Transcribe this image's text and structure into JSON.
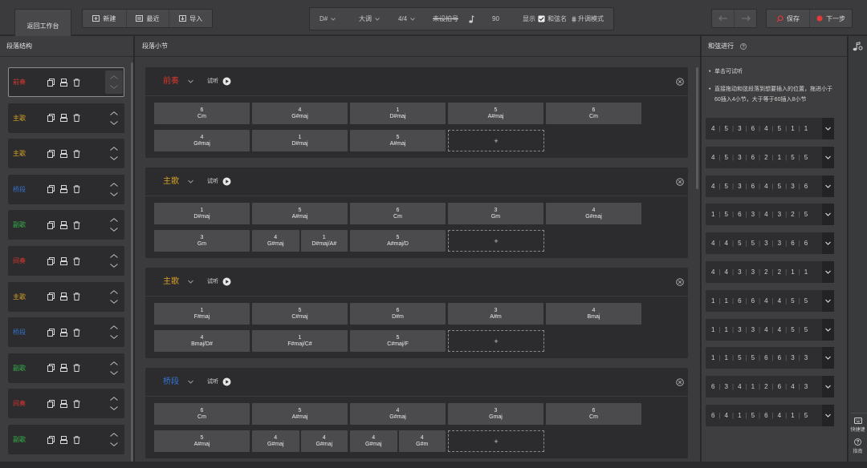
{
  "toolbar": {
    "back_label": "返回工作台",
    "new_label": "新建",
    "recent_label": "最近",
    "import_label": "导入",
    "key": "D#",
    "mode": "大调",
    "time_signature": "4/4",
    "struck_item": "未设拍号",
    "tempo": "90",
    "show_label": "显示",
    "chord_name_label": "和弦名",
    "chord_name_checked": true,
    "sharp_mode_label": "升调模式",
    "save_label": "保存",
    "next_label": "下一步"
  },
  "section_panel": {
    "title": "段落结构",
    "items": [
      {
        "label": "前奏",
        "color": "#d9362e",
        "selected": true
      },
      {
        "label": "主歌",
        "color": "#d6a024"
      },
      {
        "label": "主歌",
        "color": "#d6a024"
      },
      {
        "label": "桥段",
        "color": "#3575d4"
      },
      {
        "label": "副歌",
        "color": "#35b04a"
      },
      {
        "label": "间奏",
        "color": "#d9362e"
      },
      {
        "label": "主歌",
        "color": "#d6a024"
      },
      {
        "label": "桥段",
        "color": "#3575d4"
      },
      {
        "label": "副歌",
        "color": "#35b04a"
      },
      {
        "label": "间奏",
        "color": "#d9362e"
      },
      {
        "label": "副歌",
        "color": "#35b04a"
      }
    ]
  },
  "bar_panel": {
    "title": "段落小节",
    "listen_label": "试听",
    "add_symbol": "+",
    "sections": [
      {
        "title": "前奏",
        "color": "#d9362e",
        "rows": [
          [
            {
              "type": "bar",
              "chords": [
                {
                  "degree": "6",
                  "name": "Cm"
                }
              ]
            },
            {
              "type": "bar",
              "chords": [
                {
                  "degree": "4",
                  "name": "G#maj"
                }
              ]
            },
            {
              "type": "bar",
              "chords": [
                {
                  "degree": "1",
                  "name": "D#maj"
                }
              ]
            },
            {
              "type": "bar",
              "chords": [
                {
                  "degree": "5",
                  "name": "A#maj"
                }
              ]
            },
            {
              "type": "bar",
              "chords": [
                {
                  "degree": "6",
                  "name": "Cm"
                }
              ]
            }
          ],
          [
            {
              "type": "bar",
              "chords": [
                {
                  "degree": "4",
                  "name": "G#maj"
                }
              ]
            },
            {
              "type": "bar",
              "chords": [
                {
                  "degree": "1",
                  "name": "D#maj"
                }
              ]
            },
            {
              "type": "bar",
              "chords": [
                {
                  "degree": "5",
                  "name": "A#maj"
                }
              ]
            },
            {
              "type": "add"
            }
          ]
        ]
      },
      {
        "title": "主歌",
        "color": "#d6a024",
        "rows": [
          [
            {
              "type": "bar",
              "chords": [
                {
                  "degree": "1",
                  "name": "D#maj"
                }
              ]
            },
            {
              "type": "bar",
              "chords": [
                {
                  "degree": "5",
                  "name": "A#maj"
                }
              ]
            },
            {
              "type": "bar",
              "chords": [
                {
                  "degree": "6",
                  "name": "Cm"
                }
              ]
            },
            {
              "type": "bar",
              "chords": [
                {
                  "degree": "3",
                  "name": "Gm"
                }
              ]
            },
            {
              "type": "bar",
              "chords": [
                {
                  "degree": "4",
                  "name": "G#maj"
                }
              ]
            }
          ],
          [
            {
              "type": "bar",
              "chords": [
                {
                  "degree": "3",
                  "name": "Gm"
                }
              ]
            },
            {
              "type": "bar",
              "chords": [
                {
                  "degree": "4",
                  "name": "G#maj"
                },
                {
                  "degree": "1",
                  "name": "D#maj/A#"
                }
              ]
            },
            {
              "type": "bar",
              "chords": [
                {
                  "degree": "5",
                  "name": "A#maj/D"
                }
              ]
            },
            {
              "type": "add"
            }
          ]
        ]
      },
      {
        "title": "主歌",
        "color": "#d6a024",
        "rows": [
          [
            {
              "type": "bar",
              "chords": [
                {
                  "degree": "1",
                  "name": "F#maj"
                }
              ]
            },
            {
              "type": "bar",
              "chords": [
                {
                  "degree": "5",
                  "name": "C#maj"
                }
              ]
            },
            {
              "type": "bar",
              "chords": [
                {
                  "degree": "6",
                  "name": "D#m"
                }
              ]
            },
            {
              "type": "bar",
              "chords": [
                {
                  "degree": "3",
                  "name": "A#m"
                }
              ]
            },
            {
              "type": "bar",
              "chords": [
                {
                  "degree": "4",
                  "name": "Bmaj"
                }
              ]
            }
          ],
          [
            {
              "type": "bar",
              "chords": [
                {
                  "degree": "4",
                  "name": "Bmaj/D#"
                }
              ]
            },
            {
              "type": "bar",
              "chords": [
                {
                  "degree": "1",
                  "name": "F#maj/C#"
                }
              ]
            },
            {
              "type": "bar",
              "chords": [
                {
                  "degree": "5",
                  "name": "C#maj/F"
                }
              ]
            },
            {
              "type": "add"
            }
          ]
        ]
      },
      {
        "title": "桥段",
        "color": "#3575d4",
        "rows": [
          [
            {
              "type": "bar",
              "chords": [
                {
                  "degree": "6",
                  "name": "Cm"
                }
              ]
            },
            {
              "type": "bar",
              "chords": [
                {
                  "degree": "5",
                  "name": "A#maj"
                }
              ]
            },
            {
              "type": "bar",
              "chords": [
                {
                  "degree": "4",
                  "name": "G#maj"
                }
              ]
            },
            {
              "type": "bar",
              "chords": [
                {
                  "degree": "3",
                  "name": "Gmaj"
                }
              ]
            },
            {
              "type": "bar",
              "chords": [
                {
                  "degree": "6",
                  "name": "Cm"
                }
              ]
            }
          ],
          [
            {
              "type": "bar",
              "chords": [
                {
                  "degree": "5",
                  "name": "A#maj"
                }
              ]
            },
            {
              "type": "bar",
              "chords": [
                {
                  "degree": "4",
                  "name": "G#maj"
                },
                {
                  "degree": "4",
                  "name": "G#maj"
                }
              ]
            },
            {
              "type": "bar",
              "chords": [
                {
                  "degree": "4",
                  "name": "G#maj"
                },
                {
                  "degree": "4",
                  "name": "G#m"
                }
              ]
            },
            {
              "type": "add"
            }
          ]
        ]
      }
    ]
  },
  "progression_panel": {
    "title": "和弦进行",
    "tips": [
      "单击可试听",
      "直接拖动和弦段落到想要插入的位置，拖进小于60插入4小节，大于等于60插入8小节"
    ],
    "progressions": [
      [
        "4",
        "5",
        "3",
        "6",
        "4",
        "5",
        "1",
        "1"
      ],
      [
        "4",
        "5",
        "3",
        "6",
        "2",
        "1",
        "5",
        "5"
      ],
      [
        "4",
        "5",
        "3",
        "6",
        "4",
        "5",
        "3",
        "6"
      ],
      [
        "1",
        "5",
        "6",
        "3",
        "4",
        "3",
        "2",
        "5"
      ],
      [
        "4",
        "4",
        "5",
        "5",
        "3",
        "3",
        "6",
        "6"
      ],
      [
        "4",
        "4",
        "3",
        "3",
        "2",
        "2",
        "1",
        "1"
      ],
      [
        "1",
        "1",
        "6",
        "6",
        "4",
        "4",
        "5",
        "5"
      ],
      [
        "1",
        "1",
        "3",
        "3",
        "4",
        "4",
        "5",
        "5"
      ],
      [
        "1",
        "1",
        "5",
        "5",
        "6",
        "6",
        "3",
        "3"
      ],
      [
        "6",
        "3",
        "4",
        "1",
        "2",
        "6",
        "4",
        "3"
      ],
      [
        "6",
        "4",
        "1",
        "5",
        "6",
        "4",
        "1",
        "5"
      ]
    ]
  },
  "side_strip": {
    "shortcut_label": "快捷键",
    "guide_label": "指南"
  },
  "colors": {
    "accent_red": "#e23a3a",
    "panel_bg": "#3d3d3f",
    "card_bg": "#2c2c2e"
  }
}
